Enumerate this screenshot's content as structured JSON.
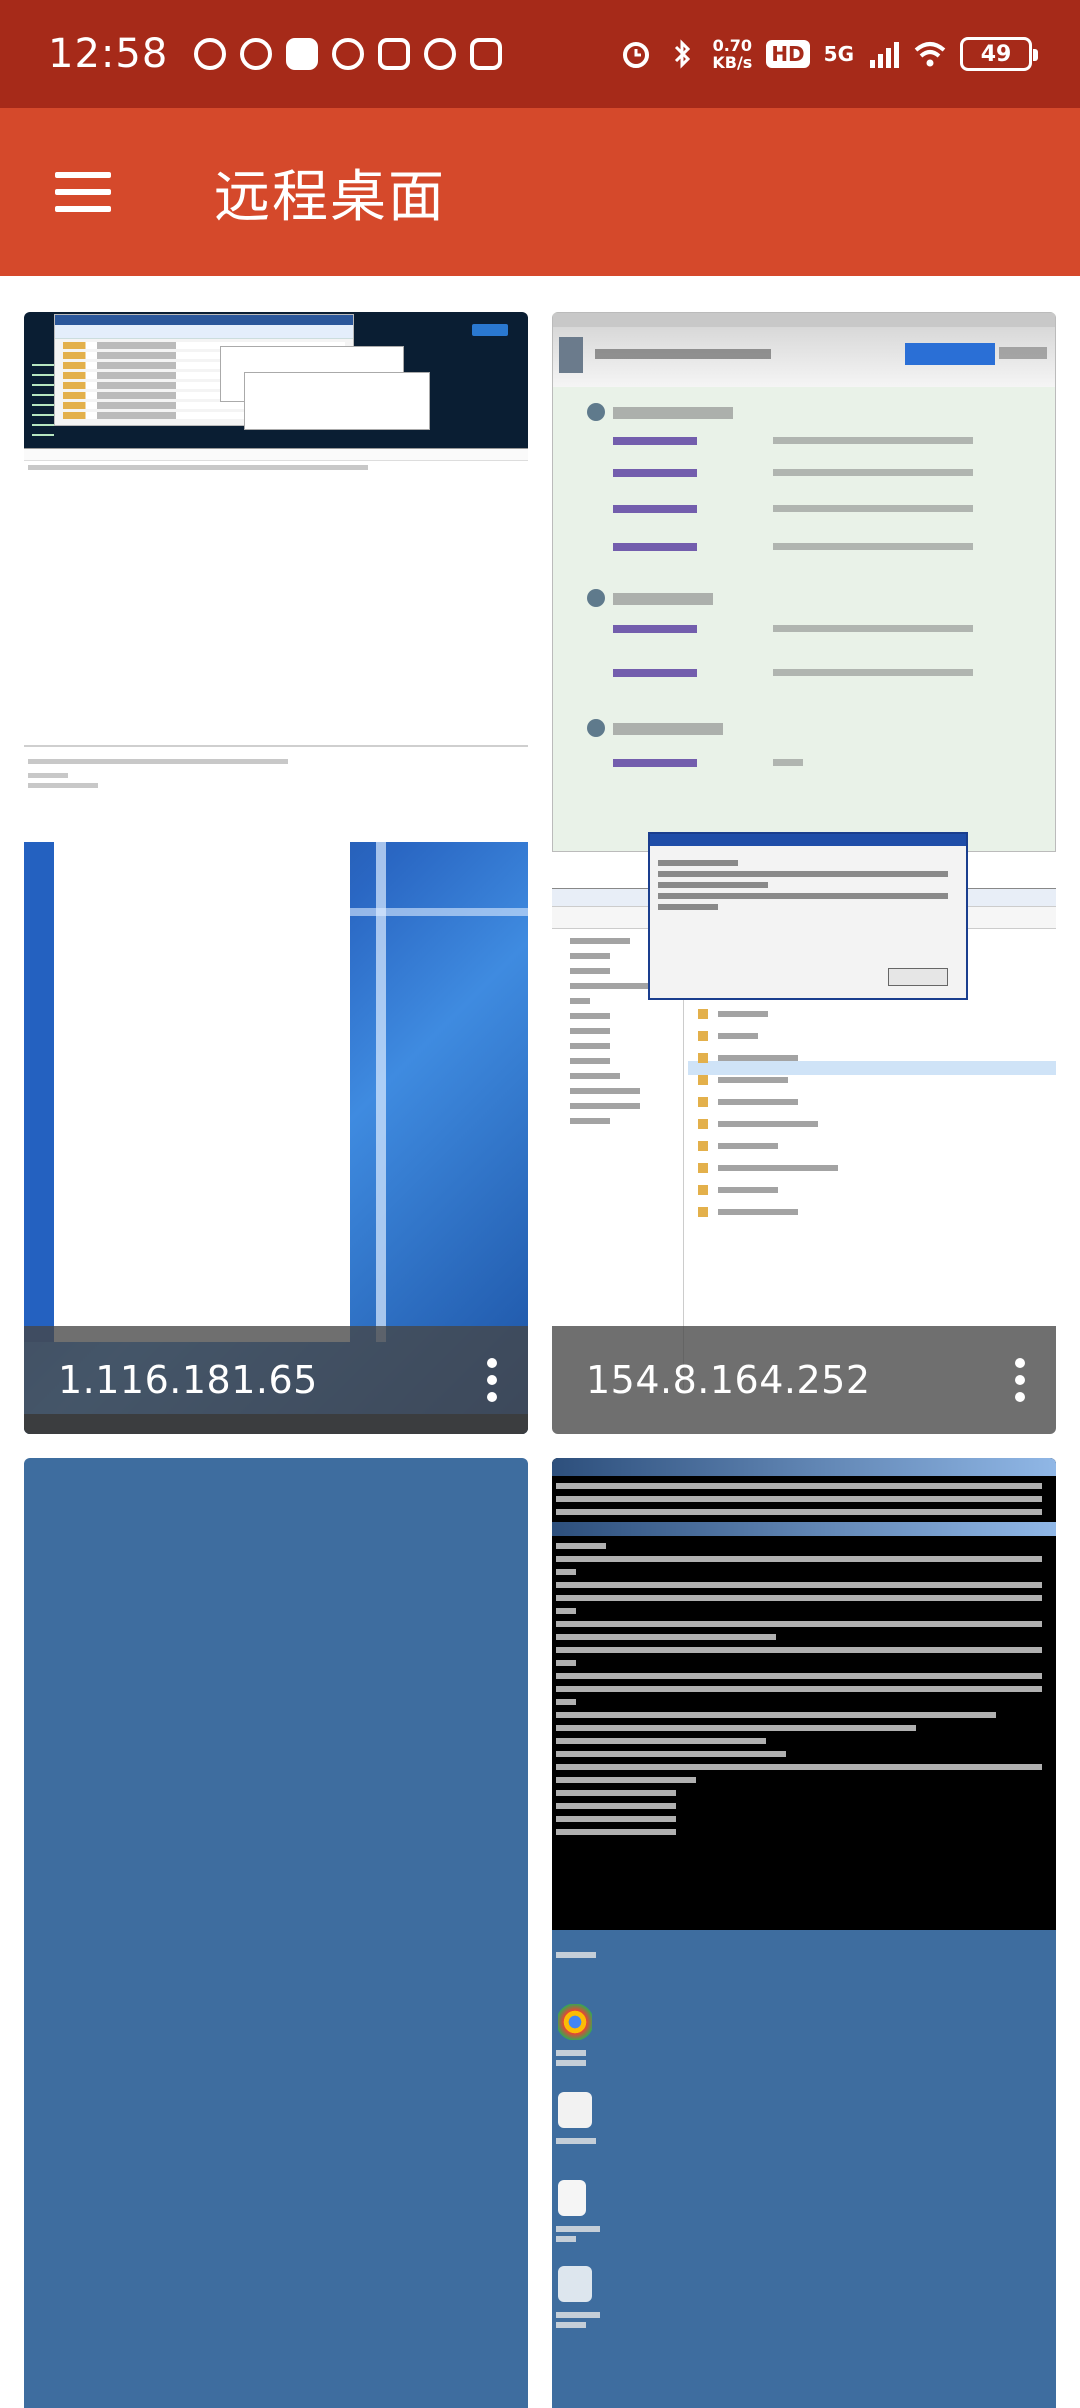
{
  "status_bar": {
    "time": "12:58",
    "net_speed_value": "0.70",
    "net_speed_unit": "KB/s",
    "hd_label": "HD",
    "network_type": "5G",
    "battery_level": "49"
  },
  "app_bar": {
    "title": "远程桌面"
  },
  "connections": [
    {
      "ip": "1.116.181.65"
    },
    {
      "ip": "154.8.164.252"
    },
    {
      "ip": ""
    },
    {
      "ip": ""
    }
  ],
  "colors": {
    "status_bar": "#a62a19",
    "app_bar": "#d5492b",
    "card_placeholder": "#3e6d9f"
  }
}
